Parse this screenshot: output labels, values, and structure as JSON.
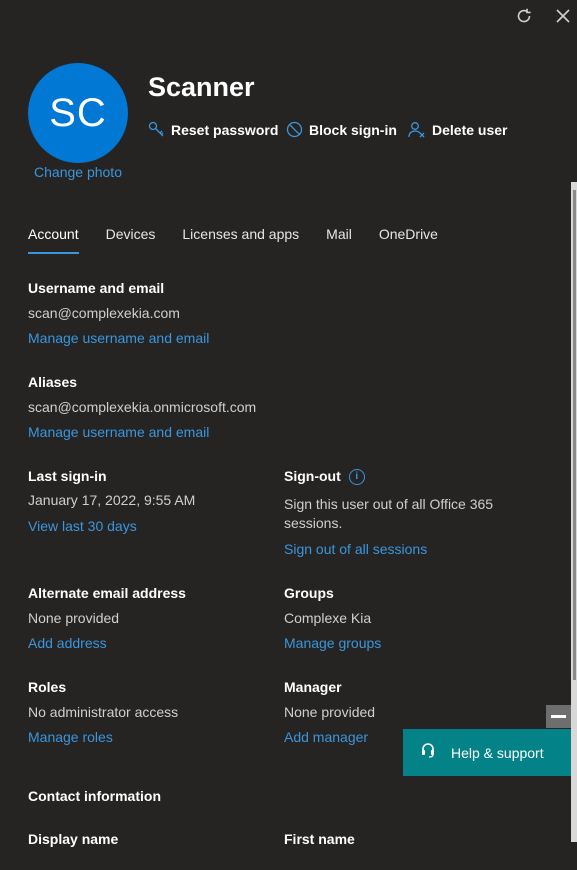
{
  "window": {
    "refresh_icon": "refresh-icon",
    "close_icon": "close-icon"
  },
  "user": {
    "initials": "SC",
    "display_name": "Scanner",
    "change_photo": "Change photo",
    "avatar_color": "#0078d4"
  },
  "actions": {
    "reset_password": "Reset password",
    "block_signin": "Block sign-in",
    "delete_user": "Delete user"
  },
  "tabs": [
    {
      "label": "Account",
      "active": true
    },
    {
      "label": "Devices",
      "active": false
    },
    {
      "label": "Licenses and apps",
      "active": false
    },
    {
      "label": "Mail",
      "active": false
    },
    {
      "label": "OneDrive",
      "active": false
    }
  ],
  "account": {
    "username": {
      "label": "Username and email",
      "value": "scan@complexekia.com",
      "link": "Manage username and email"
    },
    "aliases": {
      "label": "Aliases",
      "value": "scan@complexekia.onmicrosoft.com",
      "link": "Manage username and email"
    },
    "last_signin": {
      "label": "Last sign-in",
      "value": "January 17, 2022, 9:55 AM",
      "link": "View last 30 days"
    },
    "signout": {
      "label": "Sign-out",
      "value_line1": "Sign this user out of all Office 365",
      "value_line2": "sessions.",
      "link": "Sign out of all sessions"
    },
    "alternate_email": {
      "label": "Alternate email address",
      "value": "None provided",
      "link": "Add address"
    },
    "groups": {
      "label": "Groups",
      "value": "Complexe Kia",
      "link": "Manage groups"
    },
    "roles": {
      "label": "Roles",
      "value": "No administrator access",
      "link": "Manage roles"
    },
    "manager": {
      "label": "Manager",
      "value": "None provided",
      "link": "Add manager"
    },
    "contact": {
      "label": "Contact information",
      "display_name_label": "Display name",
      "first_name_label": "First name"
    }
  },
  "help": {
    "label": "Help & support",
    "color": "#038387"
  },
  "accent": "#3a96dd"
}
